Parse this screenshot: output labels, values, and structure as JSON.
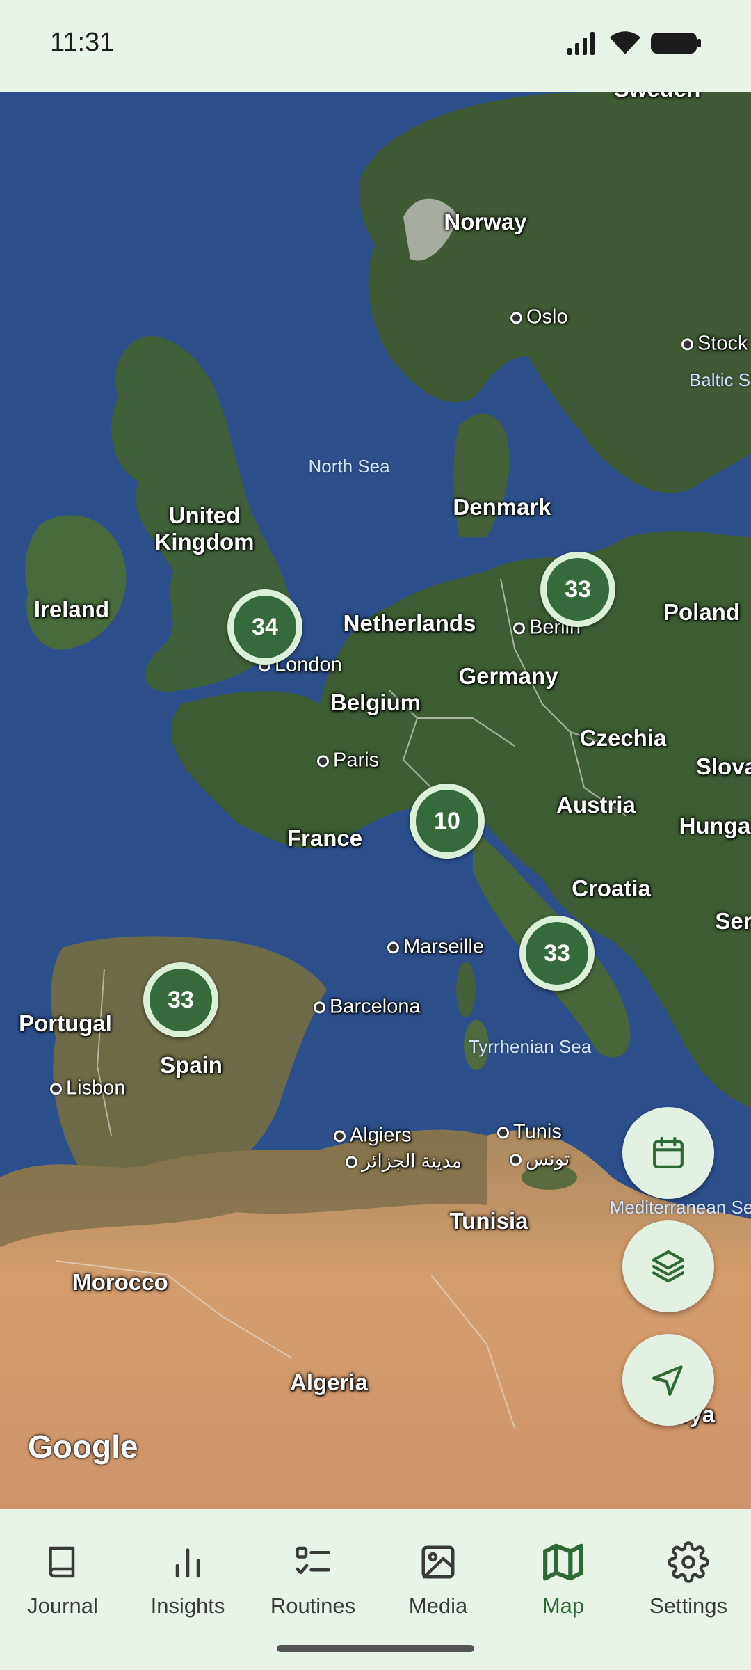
{
  "status_bar": {
    "time": "11:31"
  },
  "map": {
    "countries": {
      "sweden": "Sweden",
      "norway": "Norway",
      "denmark": "Denmark",
      "united_kingdom": "United\nKingdom",
      "ireland": "Ireland",
      "netherlands": "Netherlands",
      "poland": "Poland",
      "germany": "Germany",
      "belgium": "Belgium",
      "czechia": "Czechia",
      "slovakia": "Slova",
      "austria": "Austria",
      "hungary": "Hunga",
      "france": "France",
      "croatia": "Croatia",
      "serbia": "Ser",
      "portugal": "Portugal",
      "spain": "Spain",
      "tunisia": "Tunisia",
      "morocco": "Morocco",
      "algeria": "Algeria",
      "libya": "Libya"
    },
    "cities": {
      "oslo": "Oslo",
      "stockholm": "Stock",
      "berlin": "Berlin",
      "london": "London",
      "paris": "Paris",
      "marseille": "Marseille",
      "barcelona": "Barcelona",
      "lisbon": "Lisbon",
      "algiers": "Algiers",
      "algiers_ar": "مدينة الجزائر",
      "tunis": "Tunis",
      "tunis_ar": "تونس"
    },
    "seas": {
      "north_sea": "North Sea",
      "baltic": "Baltic S",
      "tyrrhenian": "Tyrrhenian Sea",
      "mediterranean": "Mediterranean Se"
    },
    "clusters": {
      "uk": "34",
      "berlin": "33",
      "switzerland": "10",
      "italy": "33",
      "spain": "33"
    },
    "attribution": "Google"
  },
  "fabs": {
    "calendar_icon": "calendar-icon",
    "layers_icon": "layers-icon",
    "location_icon": "navigation-arrow-icon"
  },
  "nav": {
    "items": [
      {
        "label": "Journal",
        "icon": "book-icon"
      },
      {
        "label": "Insights",
        "icon": "bar-chart-icon"
      },
      {
        "label": "Routines",
        "icon": "checklist-icon"
      },
      {
        "label": "Media",
        "icon": "image-icon"
      },
      {
        "label": "Map",
        "icon": "map-icon",
        "active": true
      },
      {
        "label": "Settings",
        "icon": "gear-icon"
      }
    ]
  },
  "colors": {
    "accent": "#356a3c",
    "surface": "#e8f4e8",
    "water": "#2d4f8c"
  }
}
